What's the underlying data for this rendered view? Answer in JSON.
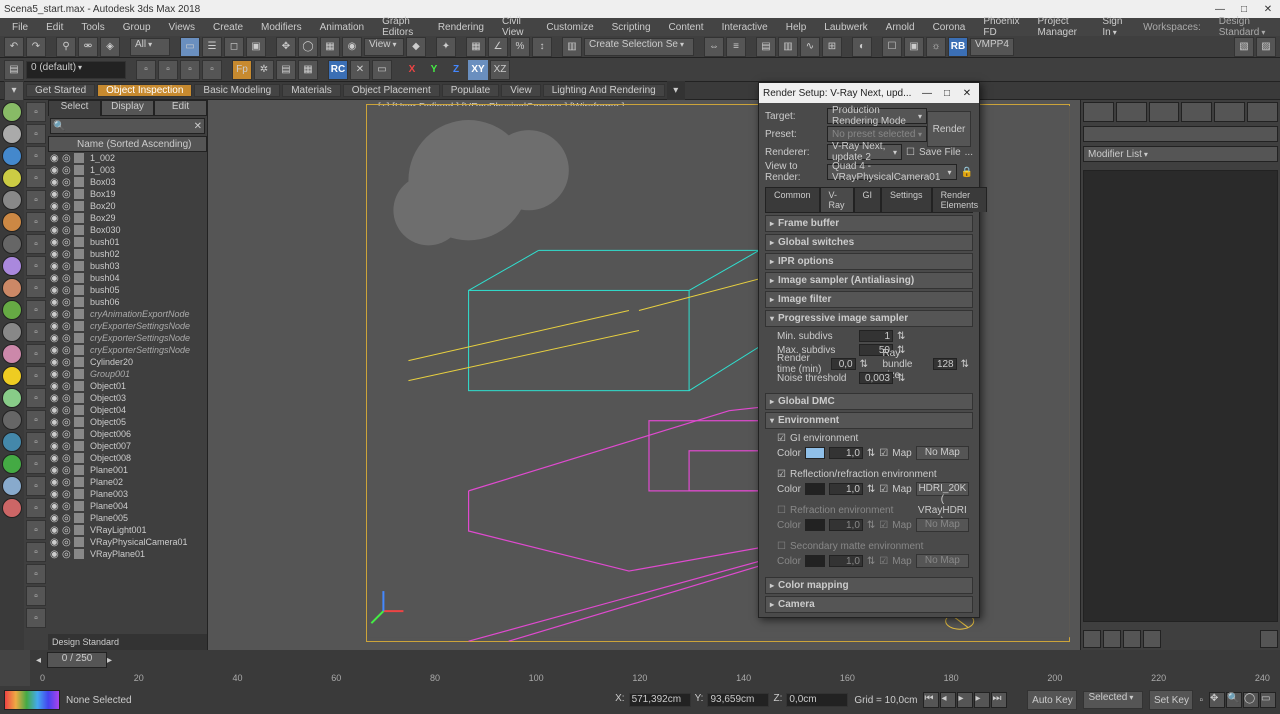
{
  "title": "Scena5_start.max - Autodesk 3ds Max 2018",
  "menubar": [
    "File",
    "Edit",
    "Tools",
    "Group",
    "Views",
    "Create",
    "Modifiers",
    "Animation",
    "Graph Editors",
    "Rendering",
    "Civil View",
    "Customize",
    "Scripting",
    "Content",
    "Interactive",
    "Help",
    "Laubwerk",
    "Arnold",
    "Corona",
    "Phoenix FD",
    "Project Manager"
  ],
  "signin": "Sign In",
  "workspaces_label": "Workspaces:",
  "workspaces_value": "Design Standard",
  "toolbar1": {
    "dropdown1": "All",
    "dropdown2": "View",
    "create_set": "Create Selection Se"
  },
  "toolbar2": {
    "layer": "0 (default)",
    "rb": "RB",
    "vmpp": "VMPP4"
  },
  "ribbon": [
    "Get Started",
    "Object Inspection",
    "Basic Modeling",
    "Materials",
    "Object Placement",
    "Populate",
    "View",
    "Lighting And Rendering"
  ],
  "ribbon_selected": 1,
  "scene_panel": {
    "tabs": [
      "Select",
      "Display",
      "Edit"
    ],
    "header": "Name (Sorted Ascending)",
    "items": [
      {
        "n": "1_002"
      },
      {
        "n": "1_003"
      },
      {
        "n": "Box03"
      },
      {
        "n": "Box19"
      },
      {
        "n": "Box20"
      },
      {
        "n": "Box29"
      },
      {
        "n": "Box030"
      },
      {
        "n": "bush01"
      },
      {
        "n": "bush02"
      },
      {
        "n": "bush03"
      },
      {
        "n": "bush04"
      },
      {
        "n": "bush05"
      },
      {
        "n": "bush06"
      },
      {
        "n": "cryAnimationExportNode",
        "g": true
      },
      {
        "n": "cryExporterSettingsNode",
        "g": true
      },
      {
        "n": "cryExporterSettingsNode",
        "g": true
      },
      {
        "n": "cryExporterSettingsNode",
        "g": true
      },
      {
        "n": "Cylinder20"
      },
      {
        "n": "Group001",
        "g": true
      },
      {
        "n": "Object01"
      },
      {
        "n": "Object03"
      },
      {
        "n": "Object04"
      },
      {
        "n": "Object05"
      },
      {
        "n": "Object006"
      },
      {
        "n": "Object007"
      },
      {
        "n": "Object008"
      },
      {
        "n": "Plane001"
      },
      {
        "n": "Plane02"
      },
      {
        "n": "Plane003"
      },
      {
        "n": "Plane004"
      },
      {
        "n": "Plane005"
      },
      {
        "n": "VRayLight001"
      },
      {
        "n": "VRayPhysicalCamera01"
      },
      {
        "n": "VRayPlane01"
      }
    ],
    "footer": "Design Standard"
  },
  "viewport_label": "[+] [User Defined ] [VRayPhysicalCamera ] [Wireframe ]",
  "right_panel": {
    "modifier_list": "Modifier List"
  },
  "dialog": {
    "title": "Render Setup: V-Ray Next, upd...",
    "rows": [
      {
        "label": "Target:",
        "value": "Production Rendering Mode"
      },
      {
        "label": "Preset:",
        "value": "No preset selected",
        "dis": true
      },
      {
        "label": "Renderer:",
        "value": "V-Ray Next, update 2",
        "extra": "Save File"
      },
      {
        "label": "View to Render:",
        "value": "Quad 4 - VRayPhysicalCamera01",
        "lock": true
      }
    ],
    "render_btn": "Render",
    "tabs": [
      "Common",
      "V-Ray",
      "GI",
      "Settings",
      "Render Elements"
    ],
    "tab_selected": 1,
    "rollouts_closed": [
      "Frame buffer",
      "Global switches",
      "IPR options",
      "Image sampler (Antialiasing)",
      "Image filter"
    ],
    "roll_progressive": "Progressive image sampler",
    "progressive": [
      {
        "l": "Min. subdivs",
        "v": "1"
      },
      {
        "l": "Max. subdivs",
        "v": "50"
      },
      {
        "l": "Render time (min)",
        "v": "0,0",
        "l2": "Ray bundle size",
        "v2": "128"
      },
      {
        "l": "Noise threshold",
        "v": "0,003"
      }
    ],
    "roll_dmc": "Global DMC",
    "roll_env": "Environment",
    "env": {
      "gi_label": "GI environment",
      "gi_color": "#8fbfe8",
      "gi_val": "1,0",
      "gi_map_cb": "Map",
      "gi_map": "No Map",
      "rr_label": "Reflection/refraction environment",
      "rr_color": "#222",
      "rr_val": "1,0",
      "rr_map_cb": "Map",
      "rr_map": "HDRI_20K ( VRayHDRI )",
      "rf_label": "Refraction environment",
      "rf_color": "#222",
      "rf_val": "1,0",
      "rf_map_cb": "Map",
      "rf_map": "No Map",
      "sm_label": "Secondary matte environment",
      "sm_color": "#222",
      "sm_val": "1,0",
      "sm_map_cb": "Map",
      "sm_map": "No Map"
    },
    "roll_cmap": "Color mapping",
    "roll_cam": "Camera"
  },
  "timeslider": "0 / 250",
  "ruler": [
    "0",
    "20",
    "40",
    "60",
    "80",
    "100",
    "120",
    "140",
    "160",
    "180",
    "200",
    "220",
    "240"
  ],
  "status": {
    "selection": "None Selected",
    "x_lbl": "X:",
    "x": "571,392cm",
    "y_lbl": "Y:",
    "y": "93,659cm",
    "z_lbl": "Z:",
    "z": "0,0cm",
    "grid": "Grid = 10,0cm",
    "autokey": "Auto Key",
    "selected": "Selected",
    "setkey": "Set Key"
  }
}
